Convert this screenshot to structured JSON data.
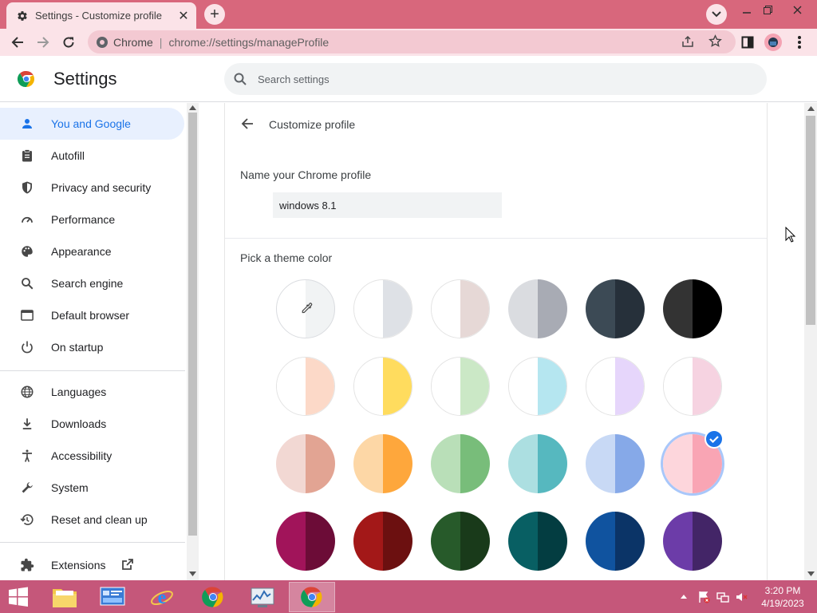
{
  "browser": {
    "tab_title": "Settings - Customize profile",
    "omnibox": {
      "site_label": "Chrome",
      "url": "chrome://settings/manageProfile"
    }
  },
  "header": {
    "title": "Settings",
    "search_placeholder": "Search settings"
  },
  "sidebar": {
    "items": [
      {
        "label": "You and Google",
        "icon": "person-icon",
        "active": true
      },
      {
        "label": "Autofill",
        "icon": "clipboard-icon"
      },
      {
        "label": "Privacy and security",
        "icon": "shield-icon"
      },
      {
        "label": "Performance",
        "icon": "speedometer-icon"
      },
      {
        "label": "Appearance",
        "icon": "palette-icon"
      },
      {
        "label": "Search engine",
        "icon": "search-icon"
      },
      {
        "label": "Default browser",
        "icon": "browser-window-icon"
      },
      {
        "label": "On startup",
        "icon": "power-icon"
      },
      {
        "label": "Languages",
        "icon": "globe-icon"
      },
      {
        "label": "Downloads",
        "icon": "download-icon"
      },
      {
        "label": "Accessibility",
        "icon": "accessibility-icon"
      },
      {
        "label": "System",
        "icon": "wrench-icon"
      },
      {
        "label": "Reset and clean up",
        "icon": "history-reset-icon"
      },
      {
        "label": "Extensions",
        "icon": "puzzle-icon"
      }
    ]
  },
  "main": {
    "page_title": "Customize profile",
    "name_label": "Name your Chrome profile",
    "name_value": "windows 8.1",
    "theme_label": "Pick a theme color",
    "theme_colors": [
      {
        "left": "#ffffff",
        "right": "#f1f3f4",
        "type": "custom"
      },
      {
        "left": "#ffffff",
        "right": "#dee1e6"
      },
      {
        "left": "#ffffff",
        "right": "#e6d8d6"
      },
      {
        "left": "#dadce0",
        "right": "#a8abb4"
      },
      {
        "left": "#3c4a55",
        "right": "#26303a"
      },
      {
        "left": "#333333",
        "right": "#000000"
      },
      {
        "left": "#ffffff",
        "right": "#fcd9c8"
      },
      {
        "left": "#ffffff",
        "right": "#ffdc5e"
      },
      {
        "left": "#ffffff",
        "right": "#cbe8c6"
      },
      {
        "left": "#ffffff",
        "right": "#b5e6f0"
      },
      {
        "left": "#ffffff",
        "right": "#e6d6fb"
      },
      {
        "left": "#ffffff",
        "right": "#f6d3e1"
      },
      {
        "left": "#f2d8d3",
        "right": "#e2a493"
      },
      {
        "left": "#fdd7a6",
        "right": "#fea73c"
      },
      {
        "left": "#b9dfb8",
        "right": "#78bd7a"
      },
      {
        "left": "#acdfe1",
        "right": "#56b8bf"
      },
      {
        "left": "#c8d9f5",
        "right": "#86a9e8"
      },
      {
        "left": "#fdd6dc",
        "right": "#f9a5b4",
        "selected": true
      },
      {
        "left": "#a1145a",
        "right": "#6c0c37"
      },
      {
        "left": "#a31818",
        "right": "#6c1010"
      },
      {
        "left": "#275a2a",
        "right": "#193a1a"
      },
      {
        "left": "#085f63",
        "right": "#033d41"
      },
      {
        "left": "#10539f",
        "right": "#0b3467"
      },
      {
        "left": "#6c3ca8",
        "right": "#432567"
      }
    ]
  },
  "taskbar": {
    "time": "3:20 PM",
    "date": "4/19/2023"
  }
}
